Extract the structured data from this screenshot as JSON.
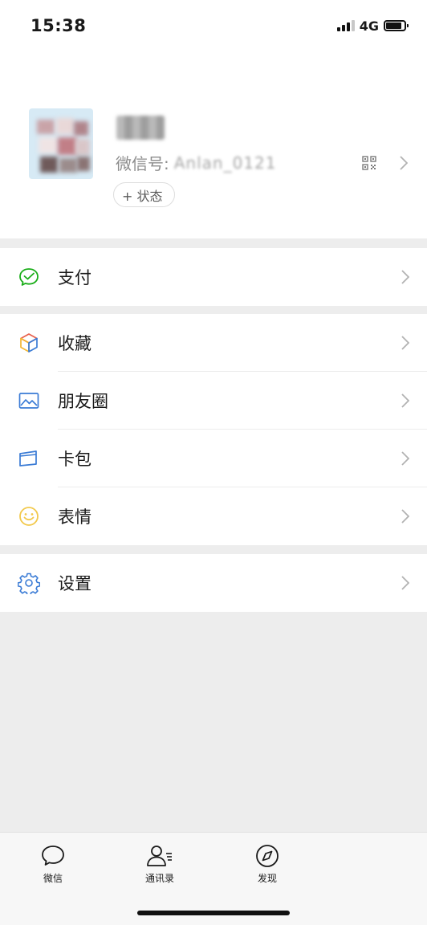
{
  "status_bar": {
    "time": "15:38",
    "network": "4G"
  },
  "profile": {
    "name": "",
    "wechat_id_label": "微信号:",
    "wechat_id_value": "Anlan_0121",
    "status_button": "+ 状态"
  },
  "menu": {
    "pay": "支付",
    "favorites": "收藏",
    "moments": "朋友圈",
    "cards": "卡包",
    "stickers": "表情",
    "settings": "设置"
  },
  "tab_bar": {
    "chats": "微信",
    "contacts": "通讯录",
    "discover": "发现"
  },
  "colors": {
    "pay_green": "#1aad19",
    "settings_blue": "#3a7bd5",
    "sticker_yellow": "#f2c94c"
  }
}
